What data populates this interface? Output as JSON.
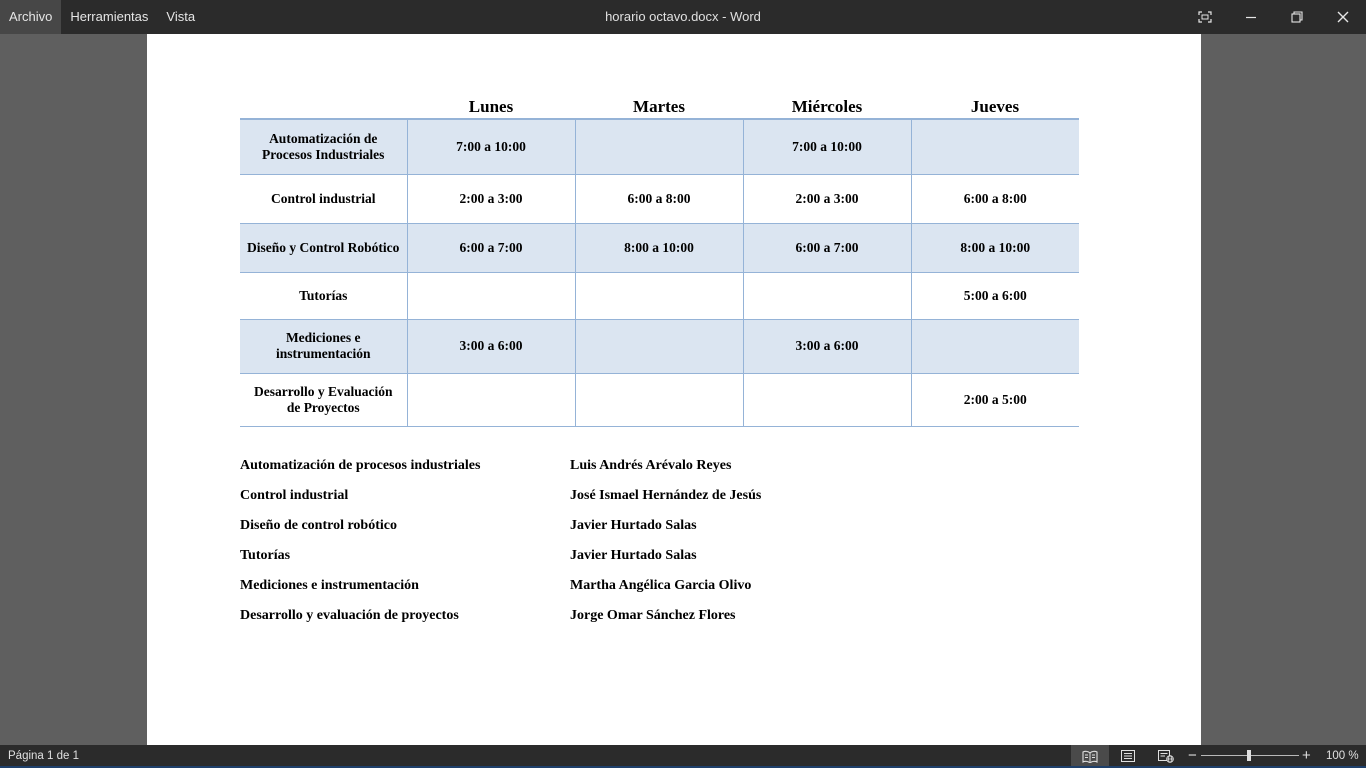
{
  "window": {
    "title": "horario octavo.docx - Word",
    "menu": [
      "Archivo",
      "Herramientas",
      "Vista"
    ],
    "active_menu": "Archivo"
  },
  "table": {
    "headers": [
      "",
      "Lunes",
      "Martes",
      "Miércoles",
      "Jueves"
    ],
    "rows": [
      {
        "subject": "Automatización de Procesos Industriales",
        "cells": [
          "7:00 a 10:00",
          "",
          "7:00 a 10:00",
          ""
        ]
      },
      {
        "subject": "Control industrial",
        "cells": [
          "2:00 a 3:00",
          "6:00 a 8:00",
          "2:00 a 3:00",
          "6:00 a 8:00"
        ]
      },
      {
        "subject": "Diseño y Control Robótico",
        "cells": [
          "6:00 a 7:00",
          "8:00 a 10:00",
          "6:00 a 7:00",
          "8:00 a 10:00"
        ]
      },
      {
        "subject": "Tutorías",
        "cells": [
          "",
          "",
          "",
          "5:00 a 6:00"
        ]
      },
      {
        "subject": "Mediciones e instrumentación",
        "cells": [
          "3:00 a 6:00",
          "",
          "3:00 a 6:00",
          ""
        ]
      },
      {
        "subject": "Desarrollo y Evaluación de Proyectos",
        "cells": [
          "",
          "",
          "",
          "2:00 a 5:00"
        ]
      }
    ],
    "band_color": "#dbe5f1",
    "border_color": "#95b3d7"
  },
  "teachers": [
    {
      "subject": "Automatización de procesos industriales",
      "teacher": "Luis Andrés Arévalo Reyes"
    },
    {
      "subject": "Control industrial",
      "teacher": "José Ismael Hernández de Jesús"
    },
    {
      "subject": "Diseño de control robótico",
      "teacher": "Javier Hurtado Salas"
    },
    {
      "subject": "Tutorías",
      "teacher": "Javier Hurtado Salas"
    },
    {
      "subject": "Mediciones e instrumentación",
      "teacher": "Martha Angélica Garcia Olivo"
    },
    {
      "subject": "Desarrollo y evaluación de proyectos",
      "teacher": "Jorge Omar Sánchez Flores"
    }
  ],
  "status": {
    "page_info": "Página 1 de 1",
    "zoom_level": "100 %",
    "zoom_percent": 100,
    "icons": [
      "read-mode-icon",
      "print-layout-icon",
      "web-layout-icon"
    ]
  }
}
